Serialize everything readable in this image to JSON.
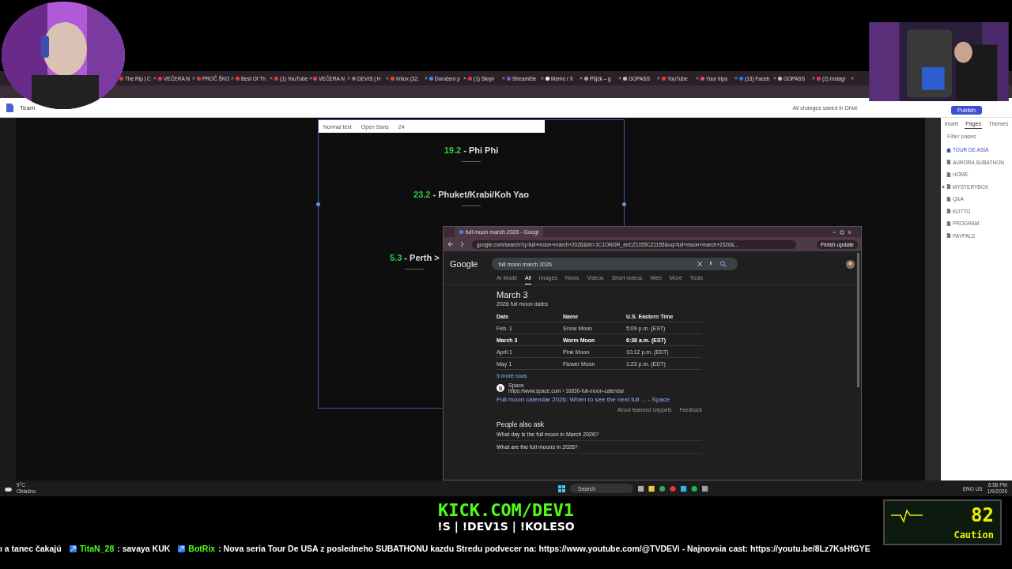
{
  "browser": {
    "tabs": [
      {
        "title": "The Rip | C",
        "color": "#e53935"
      },
      {
        "title": "VEČERA N",
        "color": "#e53935"
      },
      {
        "title": "PROČ ŠKO",
        "color": "#e53935"
      },
      {
        "title": "Best Of Th",
        "color": "#e53935"
      },
      {
        "title": "(1) YouTube",
        "color": "#e53935"
      },
      {
        "title": "VEČERA N",
        "color": "#e53935"
      },
      {
        "title": "DEVIS | H",
        "color": "#8d6e63"
      },
      {
        "title": "Inbox (32,",
        "color": "#ea4335"
      },
      {
        "title": "Doručení p",
        "color": "#4285f4"
      },
      {
        "title": "(1) Skrýv",
        "color": "#e53935"
      },
      {
        "title": "StreamEle",
        "color": "#7e57c2"
      },
      {
        "title": "Meme / X",
        "color": "#eeeeee"
      },
      {
        "title": "Půjčk – g",
        "color": "#9e9e9e"
      },
      {
        "title": "GOPASS",
        "color": "#bdbdbd"
      },
      {
        "title": "YouTube",
        "color": "#e53935"
      },
      {
        "title": "Your trips",
        "color": "#ec407a"
      },
      {
        "title": "(13) Faceb",
        "color": "#1877f2"
      },
      {
        "title": "GOPASS",
        "color": "#bdbdbd"
      },
      {
        "title": "(2) Instagr",
        "color": "#e1306c"
      }
    ]
  },
  "docs": {
    "title": "Team",
    "save_status": "All changes saved in Drive",
    "publish": "Publish",
    "format_toolbar": {
      "style": "Normal text",
      "font": "Open Sans",
      "size": "24"
    },
    "stops": [
      {
        "date": "19.2",
        "place": "- Phi Phi"
      },
      {
        "date": "23.2",
        "place": "- Phuket/Krabi/Koh Yao"
      },
      {
        "date": "5.3",
        "place": "- Perth >"
      }
    ],
    "panel": {
      "tabs": [
        {
          "label": "Insert",
          "selected": false
        },
        {
          "label": "Pages",
          "selected": true
        },
        {
          "label": "Themes",
          "selected": false
        }
      ],
      "filter_placeholder": "Filter pages",
      "pages": [
        {
          "name": "TOUR DE ASIA",
          "kind": "home",
          "selected": true,
          "expandable": false
        },
        {
          "name": "AURORA SUBATHON",
          "kind": "page",
          "selected": false,
          "expandable": false
        },
        {
          "name": "HOME",
          "kind": "page",
          "selected": false,
          "expandable": false
        },
        {
          "name": "MYSTERYBOX",
          "kind": "page",
          "selected": false,
          "expandable": true
        },
        {
          "name": "Q&A",
          "kind": "page",
          "selected": false,
          "expandable": false
        },
        {
          "name": "KOTTO",
          "kind": "page",
          "selected": false,
          "expandable": false
        },
        {
          "name": "PROGRAM",
          "kind": "page",
          "selected": false,
          "expandable": false
        },
        {
          "name": "PAYPALS",
          "kind": "page",
          "selected": false,
          "expandable": false
        }
      ]
    }
  },
  "google_window": {
    "tab": "full moon march 2026 - Googl",
    "url": "google.com/search?q=full+moon+march+2026&btr=1C1ONGR_enCZ1155CZ1155&oq=full+moon+march+2026&...",
    "finish_update": "Finish update",
    "logo": "Google",
    "query": "full moon march 2026",
    "filters": [
      {
        "label": "AI Mode",
        "selected": false
      },
      {
        "label": "All",
        "selected": true
      },
      {
        "label": "Images",
        "selected": false
      },
      {
        "label": "News",
        "selected": false
      },
      {
        "label": "Videos",
        "selected": false
      },
      {
        "label": "Short videos",
        "selected": false
      },
      {
        "label": "Web",
        "selected": false
      },
      {
        "label": "More",
        "selected": false
      },
      {
        "label": "Tools",
        "selected": false
      }
    ],
    "answer": "March 3",
    "answer_sub": "2026 full moon dates",
    "table": {
      "columns": [
        "Date",
        "Name",
        "U.S. Eastern Time"
      ],
      "rows": [
        {
          "cells": [
            "Feb. 1",
            "Snow Moon",
            "5:09 p.m. (EST)"
          ],
          "highlighted": false
        },
        {
          "cells": [
            "March 3",
            "Worm Moon",
            "6:38 a.m. (EST)"
          ],
          "highlighted": true
        },
        {
          "cells": [
            "April 1",
            "Pink Moon",
            "10:12 p.m. (EDT)"
          ],
          "highlighted": false
        },
        {
          "cells": [
            "May 1",
            "Flower Moon",
            "1:23 p.m. (EDT)"
          ],
          "highlighted": false
        }
      ]
    },
    "more_rows": "9 more rows",
    "source": {
      "initial": "S",
      "name": "Space",
      "url": "https://www.space.com › 16830-full-moon-calendar",
      "link": "Full moon calendar 2026: When to see the next full ... - Space"
    },
    "about_snippets": "About featured snippets",
    "feedback": "Feedback",
    "people_also_ask": "People also ask",
    "questions": [
      "What day is the full moon in March 2026?",
      "What are the full moons in 2026?"
    ]
  },
  "taskbar": {
    "temperature": "9°C",
    "weather": "Oblačno",
    "search": "Search",
    "language": "ENG US",
    "time": "6:58 PM",
    "date": "1/9/2026"
  },
  "overlay": {
    "site": "KICK.COM/DEV1",
    "commands": "!S | !DEV1S | !KOLESO",
    "heart_rate": "82",
    "heart_status": "Caution",
    "ticker": [
      {
        "text": "ı a tanec čakajú"
      },
      {
        "user": "TitaN_28",
        "text": ": savaya KUK"
      },
      {
        "user": "BotRix",
        "text": ": Nova seria Tour De USA z posledneho SUBATHONU kazdu Stredu podvecer na: https://www.youtube.com/@TVDEVi - Najnovsia cast: https://youtu.be/8Lz7KsHfGYE"
      }
    ]
  }
}
